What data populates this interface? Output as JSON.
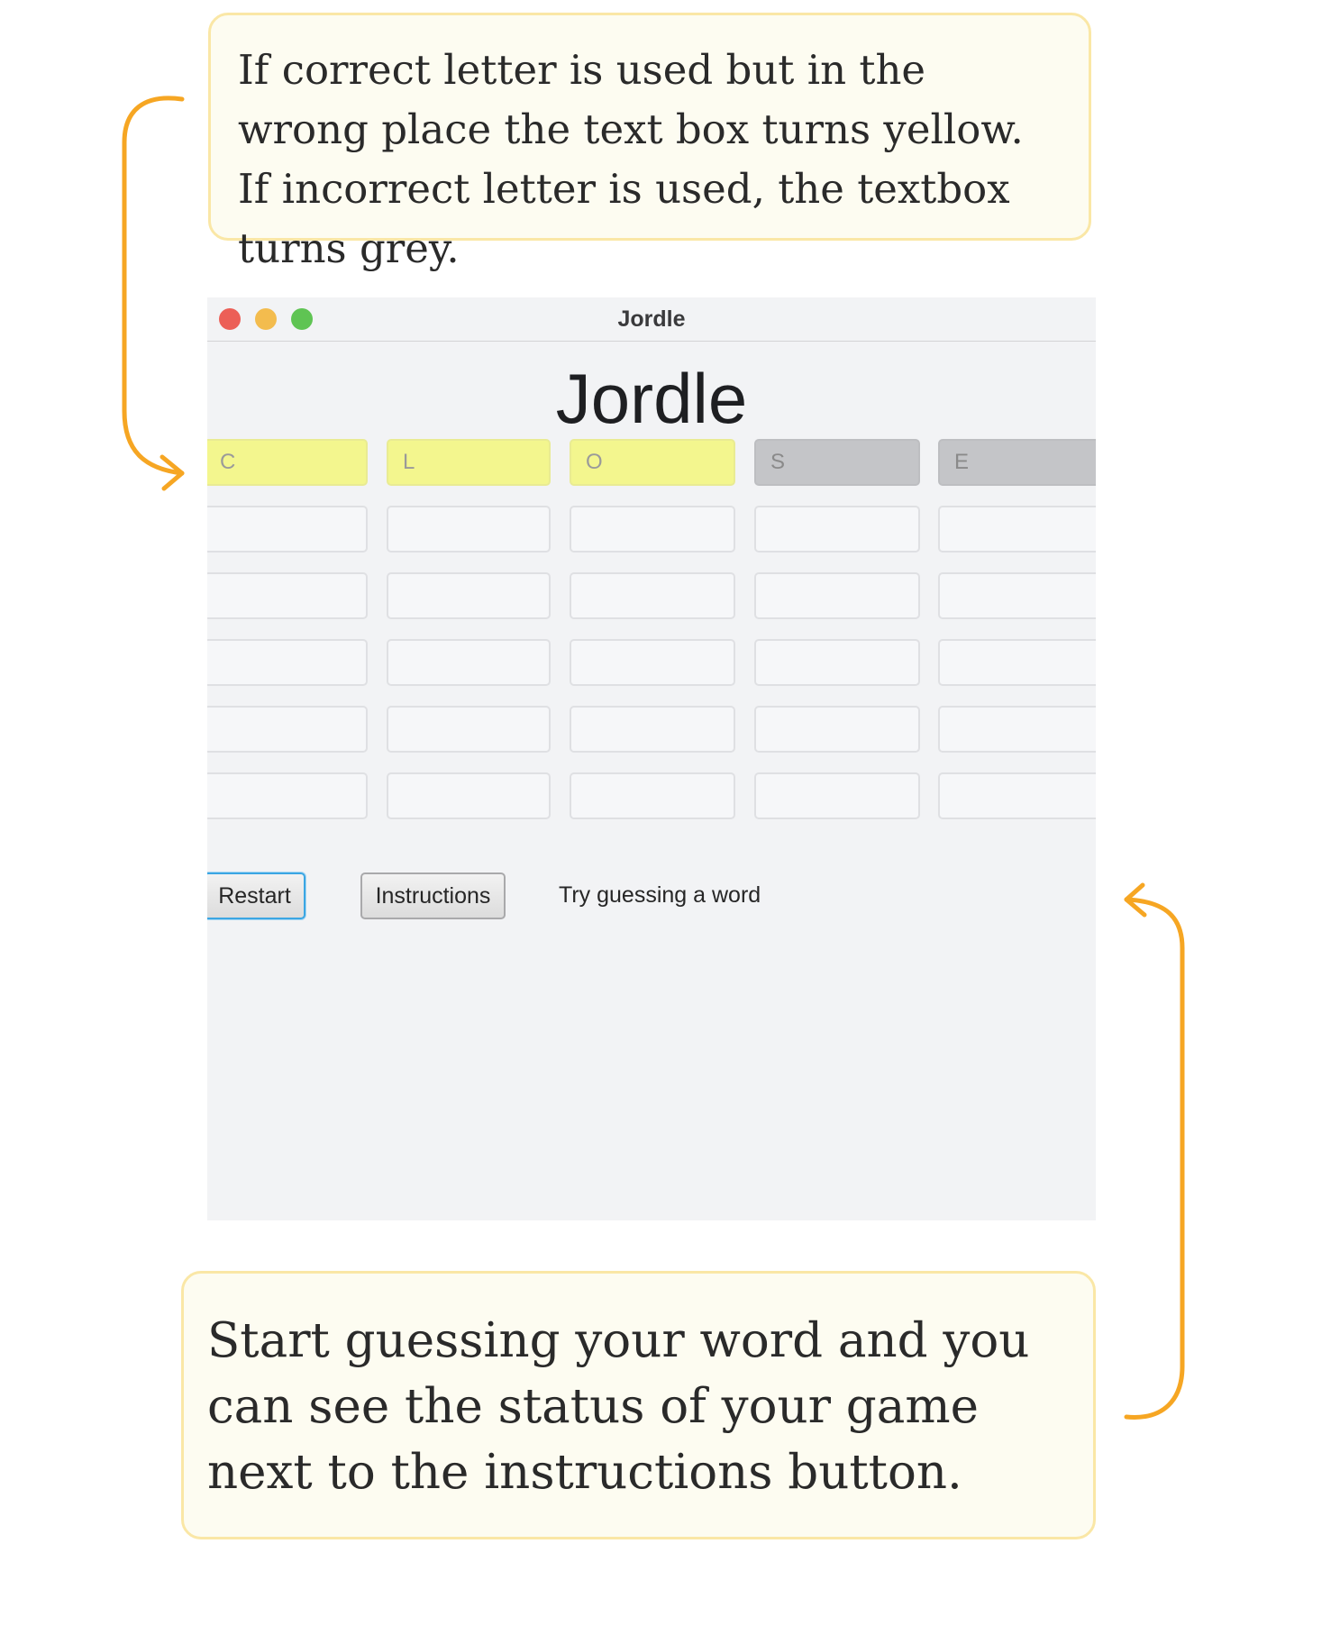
{
  "callouts": {
    "top": "If correct letter is used but in the wrong place the text box turns yellow. If incorrect letter is used, the textbox turns grey.",
    "bottom": "Start guessing your word and you can see the status of your game next to the instructions button."
  },
  "window": {
    "title": "Jordle",
    "heading": "Jordle"
  },
  "colors": {
    "wrong_place": "#f3f68e",
    "incorrect": "#c4c5c8",
    "empty": "#f6f7f9",
    "arrow": "#f6a623"
  },
  "grid": {
    "rows": [
      [
        {
          "letter": "C",
          "state": "wrong-place"
        },
        {
          "letter": "L",
          "state": "wrong-place"
        },
        {
          "letter": "O",
          "state": "wrong-place"
        },
        {
          "letter": "S",
          "state": "incorrect"
        },
        {
          "letter": "E",
          "state": "incorrect"
        }
      ],
      [
        {
          "letter": "",
          "state": "empty"
        },
        {
          "letter": "",
          "state": "empty"
        },
        {
          "letter": "",
          "state": "empty"
        },
        {
          "letter": "",
          "state": "empty"
        },
        {
          "letter": "",
          "state": "empty"
        }
      ],
      [
        {
          "letter": "",
          "state": "empty"
        },
        {
          "letter": "",
          "state": "empty"
        },
        {
          "letter": "",
          "state": "empty"
        },
        {
          "letter": "",
          "state": "empty"
        },
        {
          "letter": "",
          "state": "empty"
        }
      ],
      [
        {
          "letter": "",
          "state": "empty"
        },
        {
          "letter": "",
          "state": "empty"
        },
        {
          "letter": "",
          "state": "empty"
        },
        {
          "letter": "",
          "state": "empty"
        },
        {
          "letter": "",
          "state": "empty"
        }
      ],
      [
        {
          "letter": "",
          "state": "empty"
        },
        {
          "letter": "",
          "state": "empty"
        },
        {
          "letter": "",
          "state": "empty"
        },
        {
          "letter": "",
          "state": "empty"
        },
        {
          "letter": "",
          "state": "empty"
        }
      ],
      [
        {
          "letter": "",
          "state": "empty"
        },
        {
          "letter": "",
          "state": "empty"
        },
        {
          "letter": "",
          "state": "empty"
        },
        {
          "letter": "",
          "state": "empty"
        },
        {
          "letter": "",
          "state": "empty"
        }
      ]
    ]
  },
  "controls": {
    "restart_label": "Restart",
    "instructions_label": "Instructions",
    "status_text": "Try guessing a word"
  }
}
